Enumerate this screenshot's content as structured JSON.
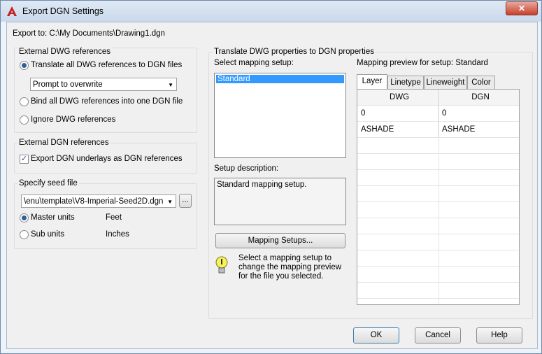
{
  "window": {
    "title": "Export DGN Settings",
    "close_glyph": "✕"
  },
  "export_to": "Export to: C:\\My Documents\\Drawing1.dgn",
  "ext_dwg": {
    "legend": "External DWG references",
    "translate_label": "Translate all DWG references to DGN files",
    "mode_value": "Prompt to overwrite",
    "bind_label": "Bind all DWG references into one DGN file",
    "ignore_label": "Ignore DWG references"
  },
  "ext_dgn": {
    "legend": "External DGN references",
    "export_label": "Export DGN underlays as DGN references",
    "checked_glyph": "✓"
  },
  "seed": {
    "legend": "Specify seed file",
    "path_value": "\\enu\\template\\V8-Imperial-Seed2D.dgn",
    "browse_label": "...",
    "master_label": "Master units",
    "master_value": "Feet",
    "sub_label": "Sub units",
    "sub_value": "Inches"
  },
  "translate": {
    "legend": "Translate DWG properties to DGN properties",
    "select_label": "Select mapping setup:",
    "setups": [
      "Standard"
    ],
    "desc_label": "Setup description:",
    "desc_value": "Standard mapping setup.",
    "mapping_button": "Mapping Setups...",
    "hint": "Select a mapping setup to change the mapping preview for the file you selected.",
    "preview_label": "Mapping preview for setup: Standard",
    "tabs": [
      "Layer",
      "Linetype",
      "Lineweight",
      "Color"
    ],
    "columns": [
      "DWG",
      "DGN"
    ],
    "rows": [
      {
        "dwg": "0",
        "dgn": "0"
      },
      {
        "dwg": "ASHADE",
        "dgn": "ASHADE"
      }
    ]
  },
  "footer": {
    "ok": "OK",
    "cancel": "Cancel",
    "help": "Help"
  },
  "icons": {
    "app": "autocad-a-icon",
    "hint": "lightbulb-icon"
  }
}
